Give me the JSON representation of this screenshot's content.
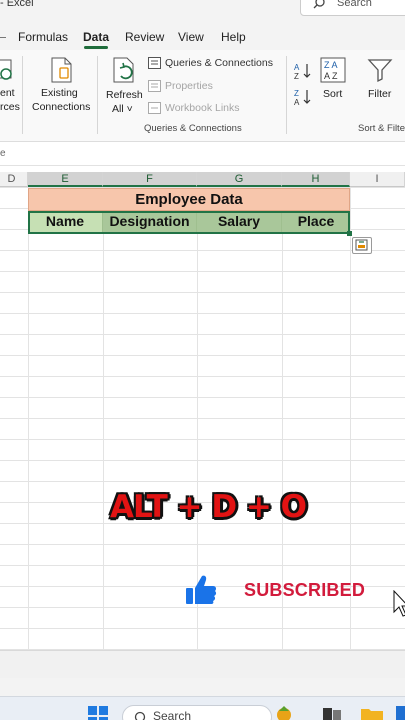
{
  "window": {
    "title": "- Excel",
    "search_label": "Search"
  },
  "menu": {
    "tabs": [
      "Formulas",
      "Data",
      "Review",
      "View",
      "Help"
    ],
    "active": "Data"
  },
  "ribbon": {
    "get_data_partial": [
      "ent",
      "rces"
    ],
    "existing_connections": [
      "Existing",
      "Connections"
    ],
    "refresh_all": [
      "Refresh",
      "All ˅"
    ],
    "queries_connections": "Queries & Connections",
    "properties": "Properties",
    "workbook_links": "Workbook Links",
    "group_queries": "Queries & Connections",
    "sort": "Sort",
    "filter": "Filter",
    "group_sort": "Sort & Filter"
  },
  "formula_bar": {
    "fx_partial": "e"
  },
  "columns": [
    "D",
    "E",
    "F",
    "G",
    "H",
    "I"
  ],
  "table": {
    "title": "Employee Data",
    "headers": [
      "Name",
      "Designation",
      "Salary",
      "Place"
    ]
  },
  "overlay": {
    "shortcut": "ALT + D + O",
    "subscribed": "SUBSCRIBED"
  },
  "taskbar": {
    "search_label": "Search"
  },
  "colors": {
    "title_fill": "#f7c6ac",
    "header_fill": "#c6e0b4",
    "header_fill_selected": "#a9c79a",
    "excel_green": "#217346",
    "shortcut_red": "#e21313",
    "subscribe_red": "#d21b3c",
    "thumb_blue": "#1a73e8"
  }
}
